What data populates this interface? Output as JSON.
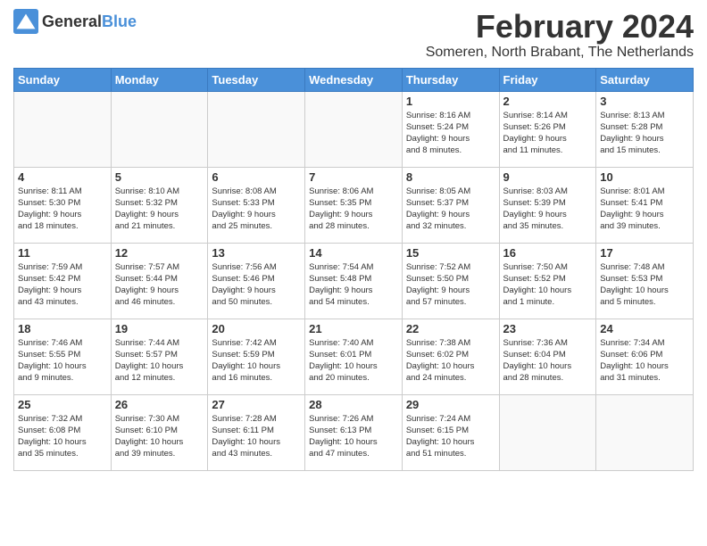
{
  "logo": {
    "general": "General",
    "blue": "Blue"
  },
  "title": {
    "month": "February 2024",
    "location": "Someren, North Brabant, The Netherlands"
  },
  "weekdays": [
    "Sunday",
    "Monday",
    "Tuesday",
    "Wednesday",
    "Thursday",
    "Friday",
    "Saturday"
  ],
  "weeks": [
    [
      {
        "day": "",
        "info": ""
      },
      {
        "day": "",
        "info": ""
      },
      {
        "day": "",
        "info": ""
      },
      {
        "day": "",
        "info": ""
      },
      {
        "day": "1",
        "info": "Sunrise: 8:16 AM\nSunset: 5:24 PM\nDaylight: 9 hours\nand 8 minutes."
      },
      {
        "day": "2",
        "info": "Sunrise: 8:14 AM\nSunset: 5:26 PM\nDaylight: 9 hours\nand 11 minutes."
      },
      {
        "day": "3",
        "info": "Sunrise: 8:13 AM\nSunset: 5:28 PM\nDaylight: 9 hours\nand 15 minutes."
      }
    ],
    [
      {
        "day": "4",
        "info": "Sunrise: 8:11 AM\nSunset: 5:30 PM\nDaylight: 9 hours\nand 18 minutes."
      },
      {
        "day": "5",
        "info": "Sunrise: 8:10 AM\nSunset: 5:32 PM\nDaylight: 9 hours\nand 21 minutes."
      },
      {
        "day": "6",
        "info": "Sunrise: 8:08 AM\nSunset: 5:33 PM\nDaylight: 9 hours\nand 25 minutes."
      },
      {
        "day": "7",
        "info": "Sunrise: 8:06 AM\nSunset: 5:35 PM\nDaylight: 9 hours\nand 28 minutes."
      },
      {
        "day": "8",
        "info": "Sunrise: 8:05 AM\nSunset: 5:37 PM\nDaylight: 9 hours\nand 32 minutes."
      },
      {
        "day": "9",
        "info": "Sunrise: 8:03 AM\nSunset: 5:39 PM\nDaylight: 9 hours\nand 35 minutes."
      },
      {
        "day": "10",
        "info": "Sunrise: 8:01 AM\nSunset: 5:41 PM\nDaylight: 9 hours\nand 39 minutes."
      }
    ],
    [
      {
        "day": "11",
        "info": "Sunrise: 7:59 AM\nSunset: 5:42 PM\nDaylight: 9 hours\nand 43 minutes."
      },
      {
        "day": "12",
        "info": "Sunrise: 7:57 AM\nSunset: 5:44 PM\nDaylight: 9 hours\nand 46 minutes."
      },
      {
        "day": "13",
        "info": "Sunrise: 7:56 AM\nSunset: 5:46 PM\nDaylight: 9 hours\nand 50 minutes."
      },
      {
        "day": "14",
        "info": "Sunrise: 7:54 AM\nSunset: 5:48 PM\nDaylight: 9 hours\nand 54 minutes."
      },
      {
        "day": "15",
        "info": "Sunrise: 7:52 AM\nSunset: 5:50 PM\nDaylight: 9 hours\nand 57 minutes."
      },
      {
        "day": "16",
        "info": "Sunrise: 7:50 AM\nSunset: 5:52 PM\nDaylight: 10 hours\nand 1 minute."
      },
      {
        "day": "17",
        "info": "Sunrise: 7:48 AM\nSunset: 5:53 PM\nDaylight: 10 hours\nand 5 minutes."
      }
    ],
    [
      {
        "day": "18",
        "info": "Sunrise: 7:46 AM\nSunset: 5:55 PM\nDaylight: 10 hours\nand 9 minutes."
      },
      {
        "day": "19",
        "info": "Sunrise: 7:44 AM\nSunset: 5:57 PM\nDaylight: 10 hours\nand 12 minutes."
      },
      {
        "day": "20",
        "info": "Sunrise: 7:42 AM\nSunset: 5:59 PM\nDaylight: 10 hours\nand 16 minutes."
      },
      {
        "day": "21",
        "info": "Sunrise: 7:40 AM\nSunset: 6:01 PM\nDaylight: 10 hours\nand 20 minutes."
      },
      {
        "day": "22",
        "info": "Sunrise: 7:38 AM\nSunset: 6:02 PM\nDaylight: 10 hours\nand 24 minutes."
      },
      {
        "day": "23",
        "info": "Sunrise: 7:36 AM\nSunset: 6:04 PM\nDaylight: 10 hours\nand 28 minutes."
      },
      {
        "day": "24",
        "info": "Sunrise: 7:34 AM\nSunset: 6:06 PM\nDaylight: 10 hours\nand 31 minutes."
      }
    ],
    [
      {
        "day": "25",
        "info": "Sunrise: 7:32 AM\nSunset: 6:08 PM\nDaylight: 10 hours\nand 35 minutes."
      },
      {
        "day": "26",
        "info": "Sunrise: 7:30 AM\nSunset: 6:10 PM\nDaylight: 10 hours\nand 39 minutes."
      },
      {
        "day": "27",
        "info": "Sunrise: 7:28 AM\nSunset: 6:11 PM\nDaylight: 10 hours\nand 43 minutes."
      },
      {
        "day": "28",
        "info": "Sunrise: 7:26 AM\nSunset: 6:13 PM\nDaylight: 10 hours\nand 47 minutes."
      },
      {
        "day": "29",
        "info": "Sunrise: 7:24 AM\nSunset: 6:15 PM\nDaylight: 10 hours\nand 51 minutes."
      },
      {
        "day": "",
        "info": ""
      },
      {
        "day": "",
        "info": ""
      }
    ]
  ]
}
